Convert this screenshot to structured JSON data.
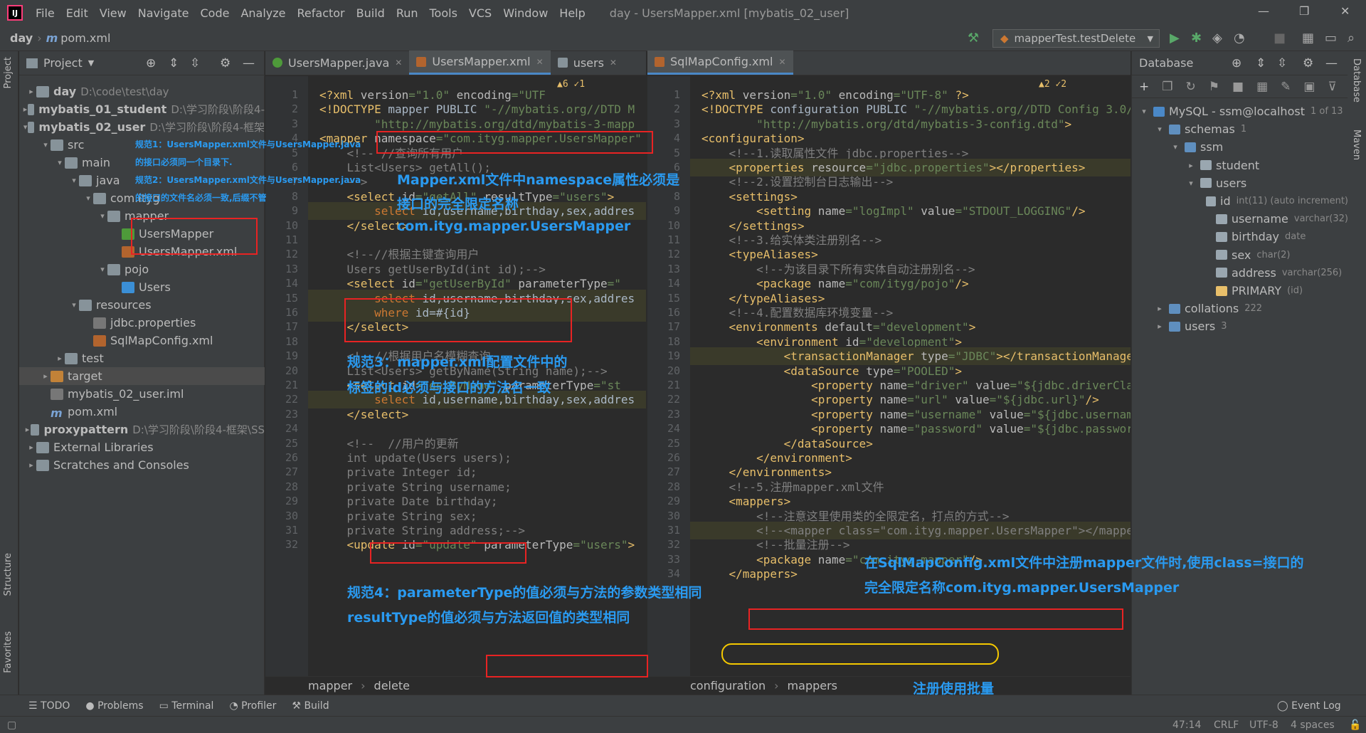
{
  "window": {
    "logo_text": "IJ",
    "menu": [
      "File",
      "Edit",
      "View",
      "Navigate",
      "Code",
      "Analyze",
      "Refactor",
      "Build",
      "Run",
      "Tools",
      "VCS",
      "Window",
      "Help"
    ],
    "title": "day - UsersMapper.xml [mybatis_02_user]"
  },
  "navbar": {
    "crumbs": [
      "day",
      "pom.xml"
    ],
    "run_config": "mapperTest.testDelete"
  },
  "strips": {
    "left_top": "Project",
    "left_mid": "Structure",
    "left_bottom": "Favorites",
    "right_top": "Database",
    "right_mid": "Maven"
  },
  "project": {
    "header": "Project",
    "tree": [
      {
        "label": "day",
        "hint": "D:\\code\\test\\day",
        "depth": 0,
        "arrow": "▸",
        "icon": "folder",
        "bold": true
      },
      {
        "label": "mybatis_01_student",
        "hint": "D:\\学习阶段\\阶段4-",
        "depth": 0,
        "arrow": "▸",
        "icon": "folder",
        "bold": true
      },
      {
        "label": "mybatis_02_user",
        "hint": "D:\\学习阶段\\阶段4-框架",
        "depth": 0,
        "arrow": "▾",
        "icon": "folder",
        "bold": true
      },
      {
        "label": "src",
        "hint": "",
        "depth": 1,
        "arrow": "▾",
        "icon": "folder"
      },
      {
        "label": "main",
        "hint": "",
        "depth": 2,
        "arrow": "▾",
        "icon": "folder"
      },
      {
        "label": "java",
        "hint": "",
        "depth": 3,
        "arrow": "▾",
        "icon": "folder"
      },
      {
        "label": "com.ityg",
        "hint": "",
        "depth": 4,
        "arrow": "▾",
        "icon": "folder"
      },
      {
        "label": "mapper",
        "hint": "",
        "depth": 5,
        "arrow": "▾",
        "icon": "folder"
      },
      {
        "label": "UsersMapper",
        "hint": "",
        "depth": 6,
        "arrow": "",
        "icon": "file-java"
      },
      {
        "label": "UsersMapper.xml",
        "hint": "",
        "depth": 6,
        "arrow": "",
        "icon": "file-xml"
      },
      {
        "label": "pojo",
        "hint": "",
        "depth": 5,
        "arrow": "▾",
        "icon": "folder"
      },
      {
        "label": "Users",
        "hint": "",
        "depth": 6,
        "arrow": "",
        "icon": "file-class"
      },
      {
        "label": "resources",
        "hint": "",
        "depth": 3,
        "arrow": "▾",
        "icon": "folder"
      },
      {
        "label": "jdbc.properties",
        "hint": "",
        "depth": 4,
        "arrow": "",
        "icon": "file-iml"
      },
      {
        "label": "SqlMapConfig.xml",
        "hint": "",
        "depth": 4,
        "arrow": "",
        "icon": "file-xml"
      },
      {
        "label": "test",
        "hint": "",
        "depth": 2,
        "arrow": "▸",
        "icon": "folder"
      },
      {
        "label": "target",
        "hint": "",
        "depth": 1,
        "arrow": "▸",
        "icon": "folder-orange"
      },
      {
        "label": "mybatis_02_user.iml",
        "hint": "",
        "depth": 1,
        "arrow": "",
        "icon": "file-iml"
      },
      {
        "label": "pom.xml",
        "hint": "",
        "depth": 1,
        "arrow": "",
        "icon": "file-m"
      },
      {
        "label": "proxypattern",
        "hint": "D:\\学习阶段\\阶段4-框架\\SS",
        "depth": 0,
        "arrow": "▸",
        "icon": "folder",
        "bold": true
      },
      {
        "label": "External Libraries",
        "hint": "",
        "depth": 0,
        "arrow": "▸",
        "icon": "folder"
      },
      {
        "label": "Scratches and Consoles",
        "hint": "",
        "depth": 0,
        "arrow": "▸",
        "icon": "folder"
      }
    ]
  },
  "editor1": {
    "tabs": [
      {
        "label": "UsersMapper.java",
        "active": false
      },
      {
        "label": "UsersMapper.xml",
        "active": true
      },
      {
        "label": "users",
        "active": false
      }
    ],
    "inspections": "▲6  ✓1",
    "lines": [
      {
        "n": "1",
        "html": "<span class='k'>&lt;?xml </span><span class='a'>version</span><span class='v'>=\"1.0\"</span> <span class='a'>encoding</span><span class='v'>=\"UTF</span>"
      },
      {
        "n": "2",
        "html": "<span class='k'>&lt;!DOCTYPE </span><span class='t'>mapper PUBLIC </span><span class='v'>\"-//mybatis.org//DTD M</span>"
      },
      {
        "n": "3",
        "html": "        <span class='v'>\"http://mybatis.org/dtd/mybatis-3-mapp</span>"
      },
      {
        "n": "4",
        "html": "<span class='k'>&lt;mapper </span><span class='a'>namespace</span><span class='v'>=\"com.ityg.mapper.UsersMapper\"</span>"
      },
      {
        "n": "5",
        "html": "    <span class='c'>&lt;!-- //查询所有用户</span>"
      },
      {
        "n": "6",
        "html": "    <span class='c'>List&lt;Users&gt; getAll();</span>"
      },
      {
        "n": "7",
        "html": "    <span class='c'>--&gt;</span>"
      },
      {
        "n": "8",
        "html": "    <span class='k'>&lt;select </span><span class='a'>id</span><span class='v'>=\"getAll\"</span> <span class='a'>resultType</span><span class='v'>=\"users\"</span><span class='k'>&gt;</span>"
      },
      {
        "n": "9",
        "html": "        <span class='sql'>select </span><span class='t'>id,username,birthday,sex,addres</span>"
      },
      {
        "n": "10",
        "html": "    <span class='k'>&lt;/select&gt;</span>"
      },
      {
        "n": "11",
        "html": ""
      },
      {
        "n": "12",
        "html": "    <span class='c'>&lt;!--//根据主键查询用户</span>"
      },
      {
        "n": "13",
        "html": "    <span class='c'>Users getUserById(int id);--&gt;</span>"
      },
      {
        "n": "14",
        "html": "    <span class='k'>&lt;select </span><span class='a'>id</span><span class='v'>=\"getUserById\"</span> <span class='a'>parameterType</span><span class='v'>=\"</span>"
      },
      {
        "n": "15",
        "html": "        <span class='sql'>select </span><span class='t'>id,username,birthday,sex,addres</span>"
      },
      {
        "n": "16",
        "html": "        <span class='sql'>where </span><span class='t'>id=#{id}</span>"
      },
      {
        "n": "17",
        "html": "    <span class='k'>&lt;/select&gt;</span>"
      },
      {
        "n": "18",
        "html": ""
      },
      {
        "n": "19",
        "html": "    <span class='c'>&lt;!--//根据用户名模糊查询</span>"
      },
      {
        "n": "20",
        "html": "    <span class='c'>List&lt;Users&gt; getByName(String name);--&gt;</span>"
      },
      {
        "n": "21",
        "html": "    <span class='k'>&lt;select </span><span class='a'>id</span><span class='v'>=\"getByName\"</span> <span class='a'>parameterType</span><span class='v'>=\"st</span>"
      },
      {
        "n": "22",
        "html": "        <span class='sql'>select </span><span class='t'>id,username,birthday,sex,addres</span>"
      },
      {
        "n": "23",
        "html": "    <span class='k'>&lt;/select&gt;</span>"
      },
      {
        "n": "24",
        "html": ""
      },
      {
        "n": "25",
        "html": "    <span class='c'>&lt;!--  //用户的更新</span>"
      },
      {
        "n": "26",
        "html": "    <span class='c'>int update(Users users);</span>"
      },
      {
        "n": "27",
        "html": "    <span class='c'>private Integer id;</span>"
      },
      {
        "n": "28",
        "html": "    <span class='c'>private String username;</span>"
      },
      {
        "n": "29",
        "html": "    <span class='c'>private Date birthday;</span>"
      },
      {
        "n": "30",
        "html": "    <span class='c'>private String sex;</span>"
      },
      {
        "n": "31",
        "html": "    <span class='c'>private String address;--&gt;</span>"
      },
      {
        "n": "32",
        "html": "    <span class='k'>&lt;update </span><span class='a'>id</span><span class='v'>=\"update\"</span> <span class='a'>parameterType</span><span class='v'>=\"users\"</span><span class='k'>&gt;</span>"
      }
    ],
    "breadcrumb": [
      "mapper",
      "delete"
    ]
  },
  "editor2": {
    "tabs": [
      {
        "label": "SqlMapConfig.xml",
        "active": true
      }
    ],
    "inspections": "▲2  ✓2",
    "lines": [
      {
        "n": "1",
        "html": "<span class='k'>&lt;?xml </span><span class='a'>version</span><span class='v'>=\"1.0\"</span> <span class='a'>encoding</span><span class='v'>=\"UTF-8\"</span> <span class='k'>?&gt;</span>"
      },
      {
        "n": "2",
        "html": "<span class='k'>&lt;!DOCTYPE </span><span class='t'>configuration PUBLIC </span><span class='v'>\"-//mybatis.org//DTD Config 3.0//EN\"</span>"
      },
      {
        "n": "3",
        "html": "        <span class='v'>\"http://mybatis.org/dtd/mybatis-3-config.dtd\"</span><span class='k'>&gt;</span>"
      },
      {
        "n": "4",
        "html": "<span class='k'>&lt;configuration&gt;</span>"
      },
      {
        "n": "5",
        "html": "    <span class='c'>&lt;!--1.读取属性文件 jdbc.properties--&gt;</span>"
      },
      {
        "n": "6",
        "html": "    <span class='k'>&lt;properties </span><span class='a'>resource</span><span class='v'>=\"jdbc.properties\"</span><span class='k'>&gt;&lt;/properties&gt;</span>"
      },
      {
        "n": "7",
        "html": "    <span class='c'>&lt;!--2.设置控制台日志输出--&gt;</span>"
      },
      {
        "n": "8",
        "html": "    <span class='k'>&lt;settings&gt;</span>"
      },
      {
        "n": "9",
        "html": "        <span class='k'>&lt;setting </span><span class='a'>name</span><span class='v'>=\"logImpl\"</span> <span class='a'>value</span><span class='v'>=\"STDOUT_LOGGING\"</span><span class='k'>/&gt;</span>"
      },
      {
        "n": "10",
        "html": "    <span class='k'>&lt;/settings&gt;</span>"
      },
      {
        "n": "11",
        "html": "    <span class='c'>&lt;!--3.给实体类注册别名--&gt;</span>"
      },
      {
        "n": "12",
        "html": "    <span class='k'>&lt;typeAliases&gt;</span>"
      },
      {
        "n": "13",
        "html": "        <span class='c'>&lt;!--为该目录下所有实体自动注册别名--&gt;</span>"
      },
      {
        "n": "14",
        "html": "        <span class='k'>&lt;package </span><span class='a'>name</span><span class='v'>=\"com/ityg/pojo\"</span><span class='k'>/&gt;</span>"
      },
      {
        "n": "15",
        "html": "    <span class='k'>&lt;/typeAliases&gt;</span>"
      },
      {
        "n": "16",
        "html": "    <span class='c'>&lt;!--4.配置数据库环境变量--&gt;</span>"
      },
      {
        "n": "17",
        "html": "    <span class='k'>&lt;environments </span><span class='a'>default</span><span class='v'>=\"development\"</span><span class='k'>&gt;</span>"
      },
      {
        "n": "18",
        "html": "        <span class='k'>&lt;environment </span><span class='a'>id</span><span class='v'>=\"development\"</span><span class='k'>&gt;</span>"
      },
      {
        "n": "19",
        "html": "            <span class='k'>&lt;transactionManager </span><span class='a'>type</span><span class='v'>=\"JDBC\"</span><span class='k'>&gt;&lt;/transactionManager&gt;</span>"
      },
      {
        "n": "20",
        "html": "            <span class='k'>&lt;dataSource </span><span class='a'>type</span><span class='v'>=\"POOLED\"</span><span class='k'>&gt;</span>"
      },
      {
        "n": "21",
        "html": "                <span class='k'>&lt;property </span><span class='a'>name</span><span class='v'>=\"driver\"</span> <span class='a'>value</span><span class='v'>=\"${jdbc.driverClassNa</span>"
      },
      {
        "n": "22",
        "html": "                <span class='k'>&lt;property </span><span class='a'>name</span><span class='v'>=\"url\"</span> <span class='a'>value</span><span class='v'>=\"${jdbc.url}\"</span><span class='k'>/&gt;</span>"
      },
      {
        "n": "23",
        "html": "                <span class='k'>&lt;property </span><span class='a'>name</span><span class='v'>=\"username\"</span> <span class='a'>value</span><span class='v'>=\"${jdbc.username}\"</span><span class='k'>/</span>"
      },
      {
        "n": "24",
        "html": "                <span class='k'>&lt;property </span><span class='a'>name</span><span class='v'>=\"password\"</span> <span class='a'>value</span><span class='v'>=\"${jdbc.password}\"</span><span class='k'>/</span>"
      },
      {
        "n": "25",
        "html": "            <span class='k'>&lt;/dataSource&gt;</span>"
      },
      {
        "n": "26",
        "html": "        <span class='k'>&lt;/environment&gt;</span>"
      },
      {
        "n": "27",
        "html": "    <span class='k'>&lt;/environments&gt;</span>"
      },
      {
        "n": "28",
        "html": "    <span class='c'>&lt;!--5.注册mapper.xml文件</span>"
      },
      {
        "n": "29",
        "html": "    <span class='k'>&lt;mappers&gt;</span>"
      },
      {
        "n": "30",
        "html": "        <span class='c'>&lt;!--注意这里使用类的全限定名，打点的方式--&gt;</span>"
      },
      {
        "n": "31",
        "html": "        <span class='c'>&lt;!--&lt;mapper class=\"com.ityg.mapper.UsersMapper\"&gt;&lt;/mapper&gt;--</span>"
      },
      {
        "n": "32",
        "html": "        <span class='c'>&lt;!--批量注册--&gt;</span>"
      },
      {
        "n": "33",
        "html": "        <span class='k'>&lt;package </span><span class='a'>name</span><span class='v'>=\"com.ityg.mapper\"</span><span class='k'>/&gt;</span>"
      },
      {
        "n": "34",
        "html": "    <span class='k'>&lt;/mappers&gt;</span>"
      }
    ],
    "breadcrumb": [
      "configuration",
      "mappers"
    ]
  },
  "database": {
    "header": "Database",
    "tree": [
      {
        "label": "MySQL - ssm@localhost",
        "meta": "1 of 13",
        "depth": 0,
        "arrow": "▾"
      },
      {
        "label": "schemas",
        "meta": "1",
        "depth": 1,
        "arrow": "▾"
      },
      {
        "label": "ssm",
        "meta": "",
        "depth": 2,
        "arrow": "▾"
      },
      {
        "label": "student",
        "meta": "",
        "depth": 3,
        "arrow": "▸"
      },
      {
        "label": "users",
        "meta": "",
        "depth": 3,
        "arrow": "▾"
      },
      {
        "label": "id",
        "meta": "int(11) (auto increment)",
        "depth": 4,
        "arrow": ""
      },
      {
        "label": "username",
        "meta": "varchar(32)",
        "depth": 4,
        "arrow": ""
      },
      {
        "label": "birthday",
        "meta": "date",
        "depth": 4,
        "arrow": ""
      },
      {
        "label": "sex",
        "meta": "char(2)",
        "depth": 4,
        "arrow": ""
      },
      {
        "label": "address",
        "meta": "varchar(256)",
        "depth": 4,
        "arrow": ""
      },
      {
        "label": "PRIMARY",
        "meta": "(id)",
        "depth": 4,
        "arrow": ""
      },
      {
        "label": "collations",
        "meta": "222",
        "depth": 1,
        "arrow": "▸"
      },
      {
        "label": "users",
        "meta": "3",
        "depth": 1,
        "arrow": "▸"
      }
    ]
  },
  "bottom": {
    "tools": [
      "TODO",
      "Problems",
      "Terminal",
      "Profiler",
      "Build"
    ],
    "event_log": "Event Log",
    "status": [
      "47:14",
      "CRLF",
      "UTF-8",
      "4 spaces"
    ]
  },
  "annotations": {
    "rule1a": "规范1：UsersMapper.xml文件与UsersMapper.java",
    "rule1b": "的接口必须同一个目录下.",
    "rule2a": "规范2：UsersMapper.xml文件与UsersMapper.java",
    "rule2b": "的接口的文件名必须一致,后缀不管",
    "ns_a": "Mapper.xml文件中namespace属性必须是",
    "ns_b": "接口的完全限定名称",
    "ns_c": "com.ityg.mapper.UsersMapper",
    "rule3a": "规范3：mapper.xml配置文件中的",
    "rule3b": "标签的id必须与接口的方法名一致",
    "rule4a": "规范4：parameterType的值必须与方法的参数类型相同",
    "rule4b": "resultType的值必须与方法返回值的类型相同",
    "cfg_a": "在SqlMapConfig.xml文件中注册mapper文件时,使用class=接口的",
    "cfg_b": "完全限定名称com.ityg.mapper.UsersMapper",
    "batch": "注册使用批量"
  }
}
